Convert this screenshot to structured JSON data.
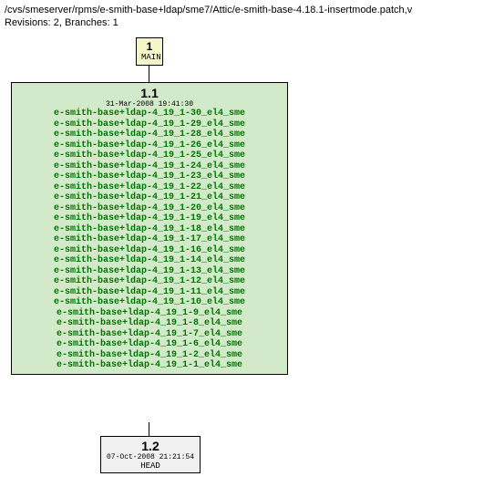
{
  "header": {
    "path": "/cvs/smeserver/rpms/e-smith-base+ldap/sme7/Attic/e-smith-base-4.18.1-insertmode.patch,v",
    "revisions": "Revisions: 2, Branches: 1"
  },
  "main_node": {
    "num": "1",
    "label": "MAIN"
  },
  "node_11": {
    "version": "1.1",
    "date": "31-Mar-2008 19:41:30",
    "tags": [
      "e-smith-base+ldap-4_19_1-30_el4_sme",
      "e-smith-base+ldap-4_19_1-29_el4_sme",
      "e-smith-base+ldap-4_19_1-28_el4_sme",
      "e-smith-base+ldap-4_19_1-26_el4_sme",
      "e-smith-base+ldap-4_19_1-25_el4_sme",
      "e-smith-base+ldap-4_19_1-24_el4_sme",
      "e-smith-base+ldap-4_19_1-23_el4_sme",
      "e-smith-base+ldap-4_19_1-22_el4_sme",
      "e-smith-base+ldap-4_19_1-21_el4_sme",
      "e-smith-base+ldap-4_19_1-20_el4_sme",
      "e-smith-base+ldap-4_19_1-19_el4_sme",
      "e-smith-base+ldap-4_19_1-18_el4_sme",
      "e-smith-base+ldap-4_19_1-17_el4_sme",
      "e-smith-base+ldap-4_19_1-16_el4_sme",
      "e-smith-base+ldap-4_19_1-14_el4_sme",
      "e-smith-base+ldap-4_19_1-13_el4_sme",
      "e-smith-base+ldap-4_19_1-12_el4_sme",
      "e-smith-base+ldap-4_19_1-11_el4_sme",
      "e-smith-base+ldap-4_19_1-10_el4_sme",
      "e-smith-base+ldap-4_19_1-9_el4_sme",
      "e-smith-base+ldap-4_19_1-8_el4_sme",
      "e-smith-base+ldap-4_19_1-7_el4_sme",
      "e-smith-base+ldap-4_19_1-6_el4_sme",
      "e-smith-base+ldap-4_19_1-2_el4_sme",
      "e-smith-base+ldap-4_19_1-1_el4_sme"
    ]
  },
  "node_12": {
    "version": "1.2",
    "date": "07-Oct-2008 21:21:54",
    "label": "HEAD"
  }
}
